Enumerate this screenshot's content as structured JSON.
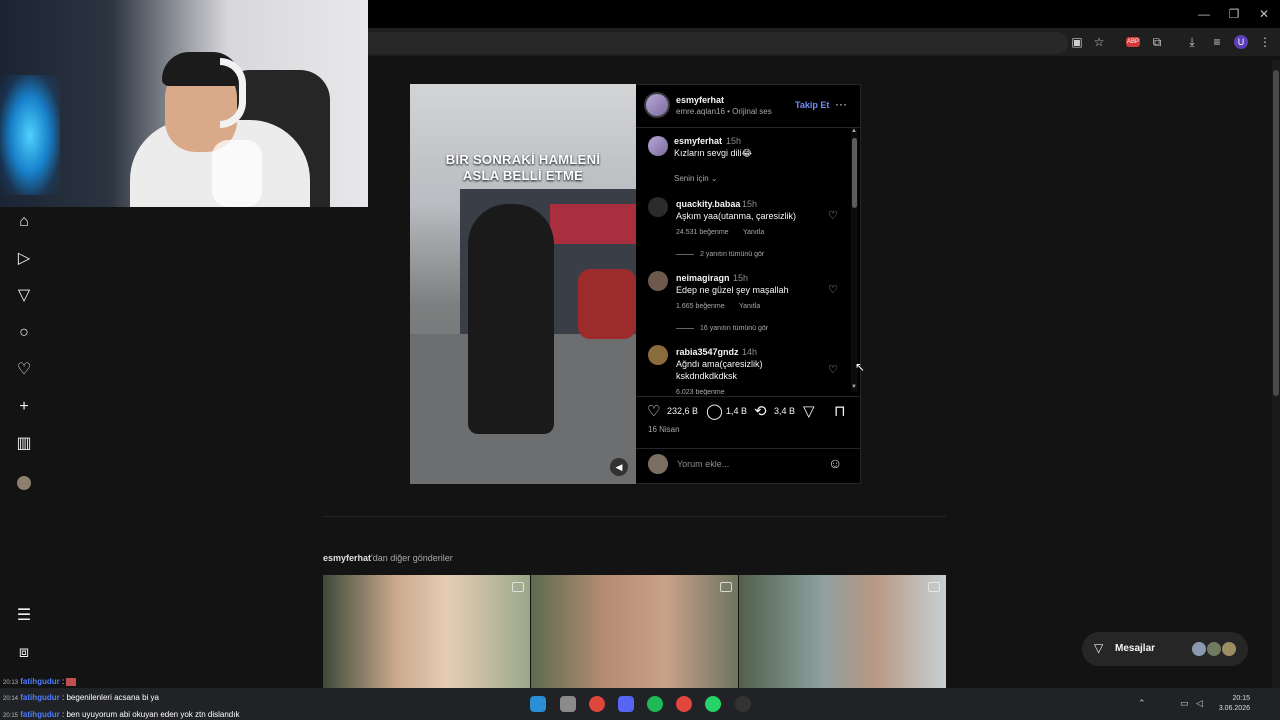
{
  "browser": {
    "window_controls": [
      "—",
      "❐",
      "✕"
    ],
    "ext_badge": "ABP",
    "profile_initial": "U",
    "icons": [
      "cast-icon",
      "bookmark-star-icon",
      "extensions-icon",
      "download-icon",
      "media-icon",
      "menu-dots-icon"
    ]
  },
  "sidebar": {
    "icons": [
      "home-icon",
      "reels-icon",
      "direct-icon",
      "search-icon",
      "notifications-heart-icon",
      "create-plus-icon",
      "dashboard-icon",
      "profile-avatar",
      "menu-icon",
      "apps-icon"
    ]
  },
  "post": {
    "video_caption": "BİR SONRAKİ HAMLENİ ASLA BELLİ ETME",
    "author": "esmyferhat",
    "audio": "emre.aqlan16 • Orijinal ses",
    "follow_label": "Takip Et",
    "caption": {
      "user": "esmyferhat",
      "time": "15h",
      "text": "Kızların sevgi dili😂"
    },
    "filter_label": "Senin için",
    "comments": [
      {
        "user": "quackity.babaa",
        "time": "15h",
        "text": "Aşkım yaa(utanma, çaresizlik)",
        "likes": "24.531 beğenme",
        "reply": "Yanıtla",
        "view_replies": "2 yanıtın tümünü gör"
      },
      {
        "user": "neimagiragn",
        "time": "15h",
        "text": "Edep ne güzel şey maşallah",
        "likes": "1.665 beğenme",
        "reply": "Yanıtla",
        "view_replies": "16 yanıtın tümünü gör"
      },
      {
        "user": "rabia3547gndz",
        "time": "14h",
        "text": "Ağndı ama(çaresizlik) kskdndkdkdksk",
        "likes": "6.023 beğenme",
        "reply": "Yanıtla"
      }
    ],
    "likes": "232,6 B",
    "comments_count": "1,4 B",
    "reposts": "3,4 B",
    "date": "16 Nisan",
    "comment_placeholder": "Yorum ekle..."
  },
  "more_posts": {
    "user": "esmyferhat",
    "suffix": "'dan diğer gönderiler"
  },
  "messages_label": "Mesajlar",
  "chat": [
    {
      "time": "20:13",
      "user": "fatihgudur",
      "text": ""
    },
    {
      "time": "20:14",
      "user": "fatihgudur",
      "text": ": begenilenleri acsana bi ya"
    },
    {
      "time": "20:15",
      "user": "fatihgudur",
      "text": ": ben uyuyorum abi okuyan eden yok ztn dislandık"
    }
  ],
  "system": {
    "time": "20:15",
    "date": "3.06.2026"
  }
}
